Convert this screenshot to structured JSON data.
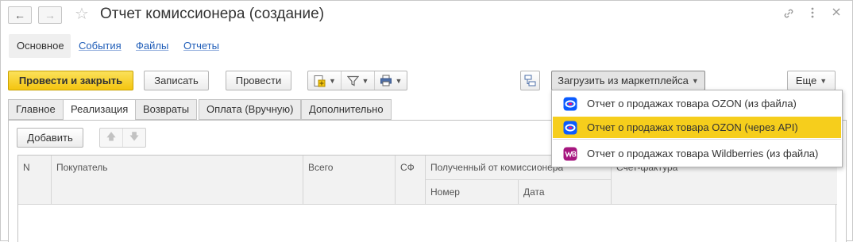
{
  "window": {
    "title": "Отчет комиссионера (создание)"
  },
  "sections": {
    "main": "Основное",
    "events": "События",
    "files": "Файлы",
    "reports": "Отчеты"
  },
  "toolbar": {
    "post_close": "Провести и закрыть",
    "write": "Записать",
    "post": "Провести",
    "marketplace": "Загрузить из маркетплейса",
    "more": "Еще"
  },
  "tabs": [
    "Главное",
    "Реализация",
    "Возвраты",
    "Оплата (Вручную)",
    "Дополнительно"
  ],
  "active_tab": "Реализация",
  "table_toolbar": {
    "add": "Добавить"
  },
  "table": {
    "columns": {
      "n": "N",
      "buyer": "Покупатель",
      "total": "Всего",
      "sf": "СФ",
      "received": "Полученный от комиссионера",
      "number": "Номер",
      "date": "Дата",
      "invoice": "Счет-фактура"
    },
    "rows": []
  },
  "dropdown_menu": {
    "items": [
      {
        "label": "Отчет о продажах товара OZON (из файла)",
        "icon": "ozon-icon",
        "highlighted": false
      },
      {
        "label": "Отчет о продажах товара OZON (через API)",
        "icon": "ozon-icon",
        "highlighted": true
      },
      {
        "label": "Отчет о продажах товара Wildberries (из файла)",
        "icon": "wildberries-icon",
        "highlighted": false
      }
    ]
  },
  "colors": {
    "primary_button": "#f4c510",
    "menu_highlight": "#f6ce1c",
    "link": "#1f5db8",
    "ozon": "#0a5bff",
    "ozon_accent": "#f1117e",
    "wildberries": "#a6167f"
  }
}
